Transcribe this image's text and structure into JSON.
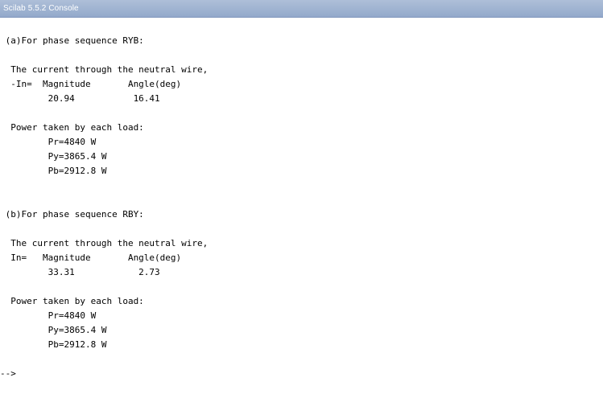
{
  "window": {
    "title": "Scilab 5.5.2 Console"
  },
  "console": {
    "lines": [
      " (a)For phase sequence RYB:",
      "  The current through the neutral wire,",
      "  -In=  Magnitude       Angle(deg)",
      "         20.94           16.41",
      "  Power taken by each load:",
      "         Pr=4840 W",
      "         Py=3865.4 W",
      "         Pb=2912.8 W",
      " (b)For phase sequence RBY:",
      "  The current through the neutral wire,",
      "  In=   Magnitude       Angle(deg)",
      "         33.31            2.73",
      "  Power taken by each load:",
      "         Pr=4840 W",
      "         Py=3865.4 W",
      "         Pb=2912.8 W"
    ],
    "prompt": "-->"
  }
}
